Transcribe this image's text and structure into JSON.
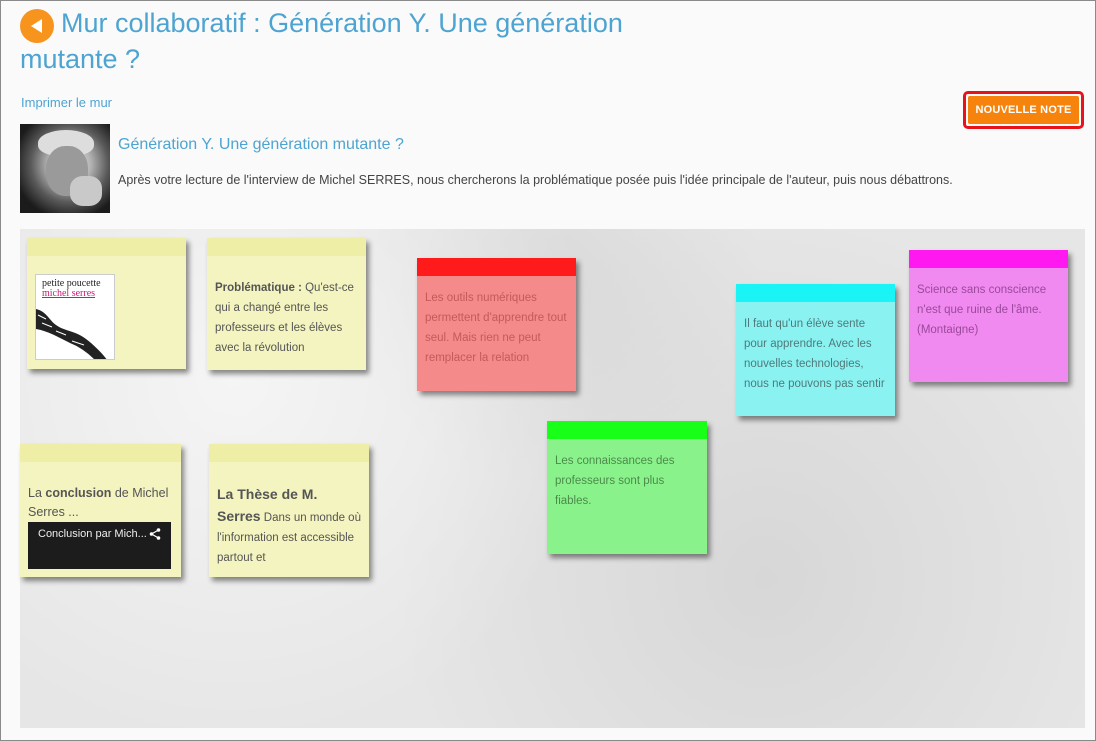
{
  "header": {
    "title_line1": "Mur collaboratif : Génération Y. Une génération",
    "title_line2": "mutante ?",
    "print_link": "Imprimer le mur",
    "new_note_button": "NOUVELLE NOTE"
  },
  "intro": {
    "heading": "Génération Y. Une génération mutante ?",
    "description": "Après votre lecture de l'interview de Michel SERRES, nous chercherons la problématique posée puis l'idée principale de l'auteur, puis nous débattrons."
  },
  "notes": {
    "book": {
      "cover_line1": "petite poucette",
      "cover_line2": "michel serres"
    },
    "problematique": {
      "bold": "Problématique :",
      "text": " Qu'est-ce qui a changé entre les professeurs et les élèves avec la révolution"
    },
    "outils": {
      "text": "Les outils numériques permettent d'apprendre tout seul. Mais rien ne peut remplacer la relation"
    },
    "eleve": {
      "text": "Il faut qu'un élève sente pour apprendre. Avec les nouvelles technologies, nous ne pouvons pas sentir"
    },
    "science": {
      "text": "Science sans conscience n'est que ruine de l'âme. (Montaigne)"
    },
    "conclusion": {
      "pre": "La ",
      "bold": "conclusion",
      "post": " de Michel Serres ...",
      "video_title": "Conclusion par Mich..."
    },
    "these": {
      "bold": "La Thèse de M. Serres",
      "text": " Dans un monde où l'information est accessible partout et"
    },
    "connaissances": {
      "text": "Les connaissances des professeurs sont plus fiables."
    }
  },
  "colors": {
    "accent": "#4ea4d1",
    "button_orange": "#f6830c",
    "note_red_band": "#ff1b1b",
    "note_red": "#f48a8a",
    "note_cyan_band": "#1af4f7",
    "note_cyan": "#8bf2f2",
    "note_magenta_band": "#ff19f0",
    "note_magenta": "#f089f0",
    "note_green_band": "#18ff18",
    "note_green": "#8af28a",
    "note_yellow": "#f4f4c0"
  },
  "icons": {
    "back": "back-arrow-icon",
    "share": "share-icon"
  }
}
